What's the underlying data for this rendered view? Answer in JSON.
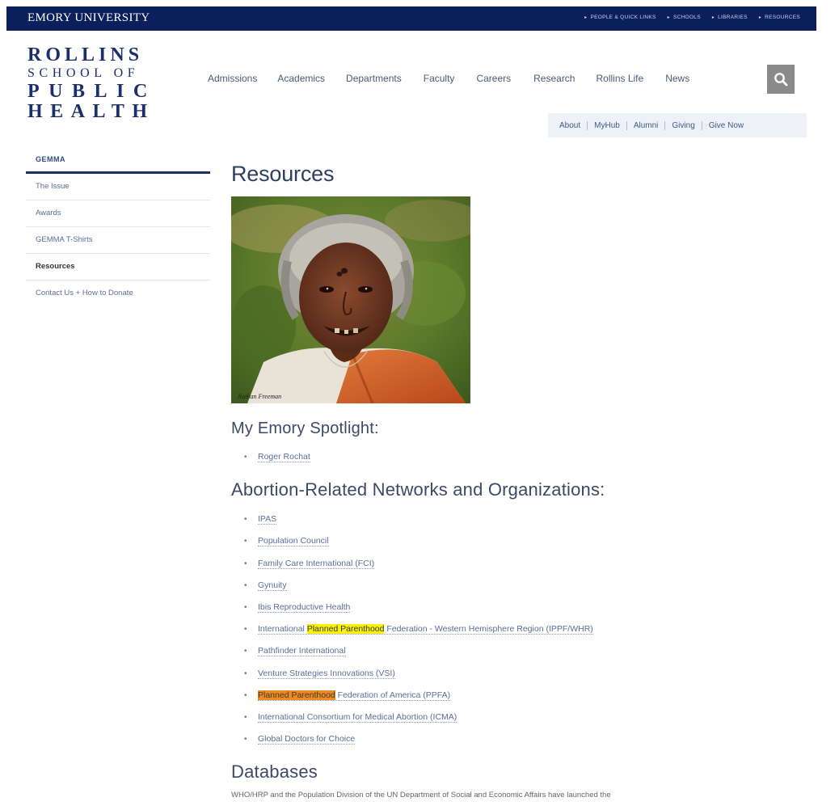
{
  "emory_bar": {
    "name": "EMORY UNIVERSITY",
    "links": [
      "PEOPLE & QUICK LINKS",
      "SCHOOLS",
      "LIBRARIES",
      "RESOURCES"
    ]
  },
  "logo": {
    "line1": "ROLLINS",
    "line2": "SCHOOL OF",
    "line3": "PUBLIC",
    "line4": "HEALTH"
  },
  "main_nav": [
    "Admissions",
    "Academics",
    "Departments",
    "Faculty",
    "Careers",
    "Research",
    "Rollins Life",
    "News"
  ],
  "secondary_nav": [
    "About",
    "MyHub",
    "Alumni",
    "Giving",
    "Give Now"
  ],
  "sidebar": {
    "heading": "GEMMA",
    "items": [
      {
        "label": "The Issue",
        "active": false
      },
      {
        "label": "Awards",
        "active": false
      },
      {
        "label": "GEMMA T-Shirts",
        "active": false
      },
      {
        "label": "Resources",
        "active": true
      },
      {
        "label": "Contact Us + How to Donate",
        "active": false
      }
    ]
  },
  "content": {
    "title": "Resources",
    "photo_caption": "Nathan Freeman",
    "spotlight_heading": "My Emory Spotlight:",
    "spotlight_items": [
      "Roger Rochat"
    ],
    "networks_heading": "Abortion-Related Networks and Organizations:",
    "networks": [
      {
        "before": "IPAS"
      },
      {
        "before": "Population Council"
      },
      {
        "before": "Family Care International (FCI)"
      },
      {
        "before": "Gynuity"
      },
      {
        "before": "Ibis Reproductive Health"
      },
      {
        "before": "International ",
        "highlight": "Planned Parenthood",
        "highlight_color": "yellow",
        "after": " Federation - Western Hemisphere Region (IPPF/WHR)"
      },
      {
        "before": "Pathfinder International"
      },
      {
        "before": "Venture Strategies Innovations (VSI)"
      },
      {
        "highlight": "Planned Parenthood",
        "highlight_color": "orange",
        "after": " Federation of America (PPFA)"
      },
      {
        "before": "International Consortium for Medical Abortion (ICMA)"
      },
      {
        "before": "Global Doctors for Choice"
      }
    ],
    "databases_heading": "Databases",
    "databases_text": "WHO/HRP and the Population Division of the UN Department of Social and Economic Affairs have launched the"
  },
  "colors": {
    "emory_blue": "#0b1f5c",
    "rollins_navy": "#1b2f6b",
    "highlight_yellow": "#f8f10a",
    "highlight_orange": "#f08a20",
    "search_gray": "#8a8a8a"
  }
}
